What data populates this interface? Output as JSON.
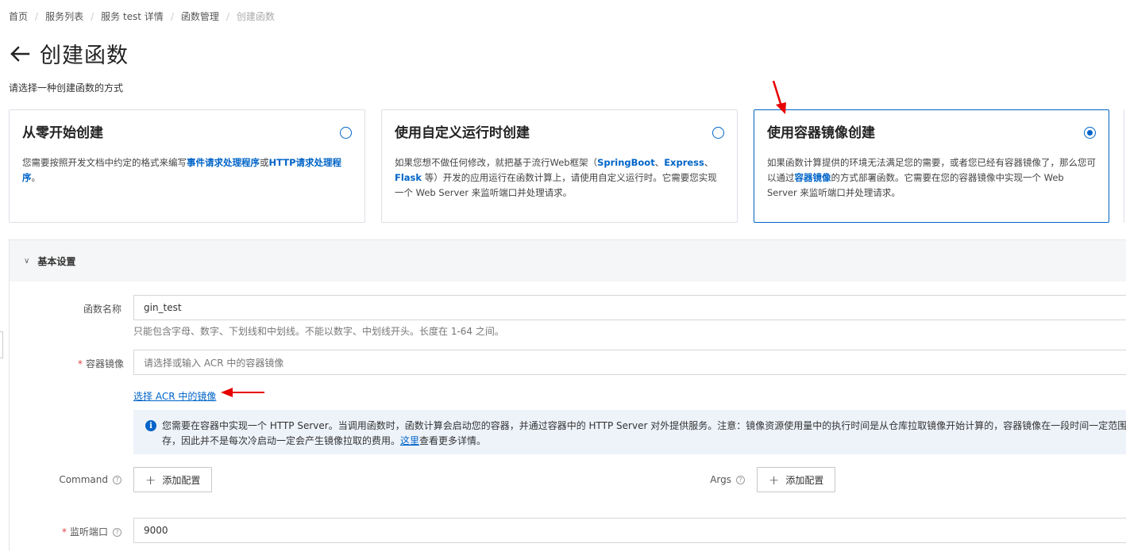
{
  "breadcrumb": [
    "首页",
    "服务列表",
    "服务 test 详情",
    "函数管理",
    "创建函数"
  ],
  "page_title": "创建函数",
  "subtitle": "请选择一种创建函数的方式",
  "cards": [
    {
      "title": "从零开始创建",
      "desc_pre": "您需要按照开发文档中约定的格式来编写",
      "desc_b1": "事件请求处理程序",
      "desc_mid": "或",
      "desc_b2": "HTTP请求处理程序",
      "desc_post": "。",
      "checked": false
    },
    {
      "title": "使用自定义运行时创建",
      "desc_pre": "如果您想不做任何修改，就把基于流行Web框架（",
      "desc_b1": "SpringBoot",
      "desc_mid": "、",
      "desc_b2": "Express",
      "desc_mid2": "、",
      "desc_b3": "Flask",
      "desc_post": " 等）开发的应用运行在函数计算上，请使用自定义运行时。它需要您实现一个 Web Server 来监听端口并处理请求。",
      "checked": false
    },
    {
      "title": "使用容器镜像创建",
      "desc_pre": "如果函数计算提供的环境无法满足您的需要，或者您已经有容器镜像了，那么您可以通过",
      "desc_b1": "容器镜像",
      "desc_post": "的方式部署函数。它需要在您的容器镜像中实现一个 Web Server 来监听端口并处理请求。",
      "checked": true
    }
  ],
  "section": {
    "title": "基本设置",
    "function_name": {
      "label": "函数名称",
      "value": "gin_test",
      "hint": "只能包含字母、数字、下划线和中划线。不能以数字、中划线开头。长度在 1-64 之间。"
    },
    "image": {
      "required": "*",
      "label": "容器镜像",
      "placeholder": "请选择或输入 ACR 中的容器镜像",
      "select_link": "选择 ACR 中的镜像"
    },
    "info": {
      "icon": "i",
      "text_line1": "您需要在容器中实现一个 HTTP Server。当调用函数时，函数计算会启动您的容器，并通过容器中的 HTTP Server 对外提供服务。注意：镜像资源使用量中的执行时间是从仓库拉取镜像开始计算的，容器镜像在一段时间一定范围内有",
      "text_line2_pre": "存，因此并不是每次冷启动一定会产生镜像拉取的费用。",
      "link": "这里",
      "text_line2_post": "查看更多详情。"
    },
    "command": {
      "label": "Command",
      "button": "添加配置"
    },
    "args": {
      "label": "Args",
      "button": "添加配置"
    },
    "port": {
      "required": "*",
      "label": "监听端口",
      "value": "9000"
    }
  },
  "colors": {
    "accent": "#0064c8",
    "annotation_arrow": "#e60000"
  }
}
